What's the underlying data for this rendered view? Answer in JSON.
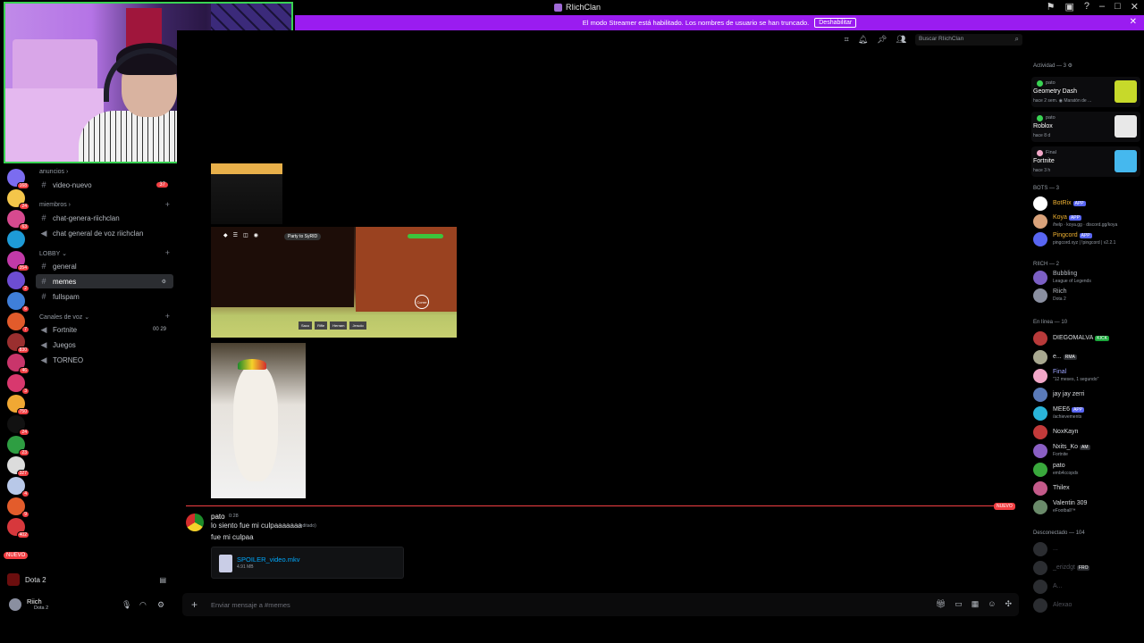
{
  "titlebar": {
    "title": "RIichClan"
  },
  "banner": {
    "text": "El modo Streamer está habilitado. Los nombres de usuario se han truncado.",
    "button": "Deshabilitar"
  },
  "servers": [
    {
      "badge": "168",
      "color": "#7b6cf0"
    },
    {
      "badge": "24",
      "color": "#f4c64a"
    },
    {
      "badge": "63",
      "color": "#d64a8f"
    },
    {
      "badge": "",
      "color": "#1e9bd7"
    },
    {
      "badge": "354",
      "color": "#c23aa8"
    },
    {
      "badge": "2",
      "color": "#6d4dd3"
    },
    {
      "badge": "6",
      "color": "#3f7fd9"
    },
    {
      "badge": "7",
      "color": "#e25b2b"
    },
    {
      "badge": "830",
      "color": "#9a2f2f"
    },
    {
      "badge": "46",
      "color": "#c9356b"
    },
    {
      "badge": "3",
      "color": "#d8386e"
    },
    {
      "badge": "750",
      "color": "#f1a833"
    },
    {
      "badge": "24",
      "color": "#111111"
    },
    {
      "badge": "23",
      "color": "#2e9e42"
    },
    {
      "badge": "327",
      "color": "#dcdcdc"
    },
    {
      "badge": "4",
      "color": "#b8c8e8"
    },
    {
      "badge": "9",
      "color": "#e35c2b"
    },
    {
      "badge": "402",
      "color": "#d7383c"
    }
  ],
  "nuevo_pill": "NUEVO",
  "channels": {
    "cat_anuncios": "anuncios",
    "video_nuevo": "video-nuevo",
    "video_nuevo_badge": "37",
    "cat_miembros": "miembros",
    "chat_genera": "chat-genera-riichclan",
    "chat_voz": "chat general de voz riichclan",
    "cat_lobby": "LOBBY",
    "general": "general",
    "memes": "memes",
    "fullspam": "fullspam",
    "cat_voz": "Canales de voz",
    "fortnite": "Fortnite",
    "fortnite_count": "00  29",
    "juegos": "Juegos",
    "torneo": "TORNEO"
  },
  "voice": {
    "server": "Dota 2"
  },
  "user": {
    "name": "Riich",
    "status": "Dota 2"
  },
  "attachments": {
    "game_chip": "Party to SyRID",
    "game_btn": "Correr",
    "game_bar": [
      "Saco",
      "Rifle",
      "Herram",
      "Jerudo"
    ]
  },
  "divider_tag": "NUEVO",
  "message": {
    "author": "pato",
    "time": "0:28",
    "line1": "lo siento fue mi culpaaaaaaa",
    "edited": "(editado)",
    "line2": "fue mi culpaa",
    "file_name": "SPOILER_video.mkv",
    "file_size": "4.91 MB"
  },
  "composer": {
    "placeholder": "Enviar mensaje a #memes"
  },
  "search": {
    "placeholder": "Buscar RIichClan"
  },
  "members": {
    "activity_header": "Actividad — 3",
    "activities": [
      {
        "user": "pato",
        "game": "Geometry Dash",
        "time": "hace 2 sem.  ◉ Maratón de ...",
        "color": "#39d353",
        "icon": "#c7d92a"
      },
      {
        "user": "pato",
        "game": "Roblox",
        "time": "hace 8 d",
        "color": "#39d353",
        "icon": "#e8e8e8"
      },
      {
        "user": "Final",
        "game": "Fortnite",
        "time": "hace 3 h",
        "color": "#f2a7c8",
        "icon": "#45b8ee"
      }
    ],
    "bots_header": "BOTS — 3",
    "bots": [
      {
        "name": "BotRix",
        "tag": "APP",
        "sub": "",
        "color": "#f0b232",
        "av": "#ffffff"
      },
      {
        "name": "Koya",
        "tag": "APP",
        "sub": "/help · koya.gg · discord.gg/koya",
        "color": "#f0b232",
        "av": "#d9a27a"
      },
      {
        "name": "Pingcord",
        "tag": "APP",
        "sub": "pingcord.xyz | !pingcord | v2.2.1",
        "color": "#f0b232",
        "av": "#5865f2"
      }
    ],
    "riich_header": "RIICH — 2",
    "riich": [
      {
        "name": "Bubbling",
        "sub": "League of Legends",
        "color": "#b5bac1",
        "av": "#7b5fc4"
      },
      {
        "name": "Riich",
        "sub": "Dota 2",
        "color": "#b5bac1",
        "av": "#8a8fa0"
      }
    ],
    "online_header": "En línea — 10",
    "online": [
      {
        "name": "DIEGOMALVA",
        "tag": "KICK",
        "sub": "",
        "color": "#dbdee1",
        "av": "#b83a3a"
      },
      {
        "name": "e...",
        "tag": "RMA",
        "sub": "",
        "color": "#dbdee1",
        "av": "#a8a890"
      },
      {
        "name": "Final",
        "tag": "",
        "sub": "\"12 meses, 1 segundo\"",
        "color": "#9da4ff",
        "av": "#f2a7c8"
      },
      {
        "name": "jay jay zerri",
        "tag": "",
        "sub": "",
        "color": "#dbdee1",
        "av": "#5a7ab8"
      },
      {
        "name": "MEE6",
        "tag": "APP",
        "sub": "/achievements",
        "color": "#dbdee1",
        "av": "#2ab5d9"
      },
      {
        "name": "NoxKayn",
        "tag": "",
        "sub": "",
        "color": "#dbdee1",
        "av": "#c23a3a"
      },
      {
        "name": "Nxits_Ko",
        "tag": "AM",
        "sub": "Fortnite",
        "color": "#dbdee1",
        "av": "#8a5fc4"
      },
      {
        "name": "pato",
        "tag": "",
        "sub": "emb4ccopdx",
        "color": "#dbdee1",
        "av": "#39a83c"
      },
      {
        "name": "Thilex",
        "tag": "",
        "sub": "",
        "color": "#dbdee1",
        "av": "#c45a8a"
      },
      {
        "name": "Valentin 309",
        "tag": "",
        "sub": "eFootball™",
        "color": "#dbdee1",
        "av": "#6a8a6a"
      }
    ],
    "offline_header": "Desconectado — 104",
    "offline": [
      {
        "name": "..."
      },
      {
        "name": "_erizdgt",
        "tag": "FRO"
      },
      {
        "name": "A..."
      },
      {
        "name": "Alexao"
      }
    ]
  }
}
